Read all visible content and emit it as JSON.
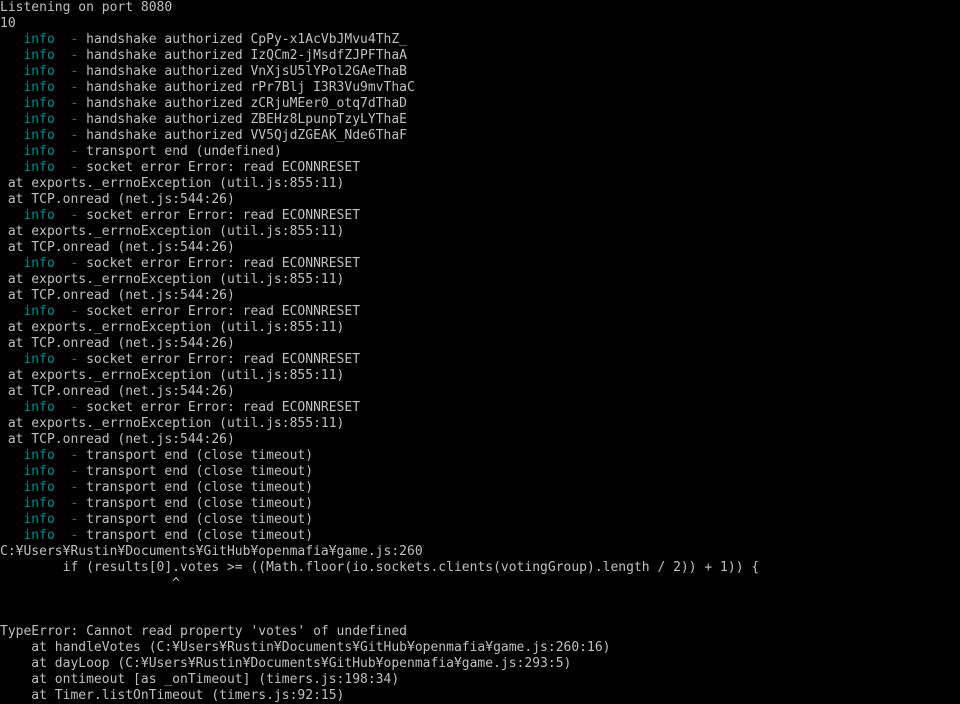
{
  "terminal": {
    "title": "node-console",
    "colors": {
      "background": "#000000",
      "foreground": "#c0c0c0",
      "info": "#008b8b"
    },
    "columns": 120,
    "rows": 44,
    "lines": [
      {
        "indent": 0,
        "parts": [
          {
            "color": "fg",
            "text": "Listening on port 8080"
          }
        ]
      },
      {
        "indent": 0,
        "parts": [
          {
            "color": "fg",
            "text": "10"
          }
        ]
      },
      {
        "indent": 0,
        "parts": [
          {
            "color": "info",
            "text": "   info  -"
          },
          {
            "color": "fg",
            "text": " handshake authorized CpPy-x1AcVbJMvu4ThZ_"
          }
        ]
      },
      {
        "indent": 0,
        "parts": [
          {
            "color": "info",
            "text": "   info  -"
          },
          {
            "color": "fg",
            "text": " handshake authorized IzQCm2-jMsdfZJPFThaA"
          }
        ]
      },
      {
        "indent": 0,
        "parts": [
          {
            "color": "info",
            "text": "   info  -"
          },
          {
            "color": "fg",
            "text": " handshake authorized VnXjsU5lYPol2GAeThaB"
          }
        ]
      },
      {
        "indent": 0,
        "parts": [
          {
            "color": "info",
            "text": "   info  -"
          },
          {
            "color": "fg",
            "text": " handshake authorized rPr7Blj I3R3Vu9mvThaC"
          }
        ]
      },
      {
        "indent": 0,
        "parts": [
          {
            "color": "info",
            "text": "   info  -"
          },
          {
            "color": "fg",
            "text": " handshake authorized zCRjuMEer0_otq7dThaD"
          }
        ]
      },
      {
        "indent": 0,
        "parts": [
          {
            "color": "info",
            "text": "   info  -"
          },
          {
            "color": "fg",
            "text": " handshake authorized ZBEHz8LpunpTzyLYThaE"
          }
        ]
      },
      {
        "indent": 0,
        "parts": [
          {
            "color": "info",
            "text": "   info  -"
          },
          {
            "color": "fg",
            "text": " handshake authorized VV5QjdZGEAK_Nde6ThaF"
          }
        ]
      },
      {
        "indent": 0,
        "parts": [
          {
            "color": "info",
            "text": "   info  -"
          },
          {
            "color": "fg",
            "text": " transport end (undefined)"
          }
        ]
      },
      {
        "indent": 0,
        "parts": [
          {
            "color": "info",
            "text": "   info  -"
          },
          {
            "color": "fg",
            "text": " socket error Error: read ECONNRESET"
          }
        ]
      },
      {
        "indent": 0,
        "parts": [
          {
            "color": "fg",
            "text": " at exports._errnoException (util.js:855:11)"
          }
        ]
      },
      {
        "indent": 0,
        "parts": [
          {
            "color": "fg",
            "text": " at TCP.onread (net.js:544:26)"
          }
        ]
      },
      {
        "indent": 0,
        "parts": [
          {
            "color": "info",
            "text": "   info  -"
          },
          {
            "color": "fg",
            "text": " socket error Error: read ECONNRESET"
          }
        ]
      },
      {
        "indent": 0,
        "parts": [
          {
            "color": "fg",
            "text": " at exports._errnoException (util.js:855:11)"
          }
        ]
      },
      {
        "indent": 0,
        "parts": [
          {
            "color": "fg",
            "text": " at TCP.onread (net.js:544:26)"
          }
        ]
      },
      {
        "indent": 0,
        "parts": [
          {
            "color": "info",
            "text": "   info  -"
          },
          {
            "color": "fg",
            "text": " socket error Error: read ECONNRESET"
          }
        ]
      },
      {
        "indent": 0,
        "parts": [
          {
            "color": "fg",
            "text": " at exports._errnoException (util.js:855:11)"
          }
        ]
      },
      {
        "indent": 0,
        "parts": [
          {
            "color": "fg",
            "text": " at TCP.onread (net.js:544:26)"
          }
        ]
      },
      {
        "indent": 0,
        "parts": [
          {
            "color": "info",
            "text": "   info  -"
          },
          {
            "color": "fg",
            "text": " socket error Error: read ECONNRESET"
          }
        ]
      },
      {
        "indent": 0,
        "parts": [
          {
            "color": "fg",
            "text": " at exports._errnoException (util.js:855:11)"
          }
        ]
      },
      {
        "indent": 0,
        "parts": [
          {
            "color": "fg",
            "text": " at TCP.onread (net.js:544:26)"
          }
        ]
      },
      {
        "indent": 0,
        "parts": [
          {
            "color": "info",
            "text": "   info  -"
          },
          {
            "color": "fg",
            "text": " socket error Error: read ECONNRESET"
          }
        ]
      },
      {
        "indent": 0,
        "parts": [
          {
            "color": "fg",
            "text": " at exports._errnoException (util.js:855:11)"
          }
        ]
      },
      {
        "indent": 0,
        "parts": [
          {
            "color": "fg",
            "text": " at TCP.onread (net.js:544:26)"
          }
        ]
      },
      {
        "indent": 0,
        "parts": [
          {
            "color": "info",
            "text": "   info  -"
          },
          {
            "color": "fg",
            "text": " socket error Error: read ECONNRESET"
          }
        ]
      },
      {
        "indent": 0,
        "parts": [
          {
            "color": "fg",
            "text": " at exports._errnoException (util.js:855:11)"
          }
        ]
      },
      {
        "indent": 0,
        "parts": [
          {
            "color": "fg",
            "text": " at TCP.onread (net.js:544:26)"
          }
        ]
      },
      {
        "indent": 0,
        "parts": [
          {
            "color": "info",
            "text": "   info  -"
          },
          {
            "color": "fg",
            "text": " transport end (close timeout)"
          }
        ]
      },
      {
        "indent": 0,
        "parts": [
          {
            "color": "info",
            "text": "   info  -"
          },
          {
            "color": "fg",
            "text": " transport end (close timeout)"
          }
        ]
      },
      {
        "indent": 0,
        "parts": [
          {
            "color": "info",
            "text": "   info  -"
          },
          {
            "color": "fg",
            "text": " transport end (close timeout)"
          }
        ]
      },
      {
        "indent": 0,
        "parts": [
          {
            "color": "info",
            "text": "   info  -"
          },
          {
            "color": "fg",
            "text": " transport end (close timeout)"
          }
        ]
      },
      {
        "indent": 0,
        "parts": [
          {
            "color": "info",
            "text": "   info  -"
          },
          {
            "color": "fg",
            "text": " transport end (close timeout)"
          }
        ]
      },
      {
        "indent": 0,
        "parts": [
          {
            "color": "info",
            "text": "   info  -"
          },
          {
            "color": "fg",
            "text": " transport end (close timeout)"
          }
        ]
      },
      {
        "indent": 0,
        "parts": [
          {
            "color": "fg",
            "text": "C:¥Users¥Rustin¥Documents¥GitHub¥openmafia¥game.js:260"
          }
        ]
      },
      {
        "indent": 0,
        "parts": [
          {
            "color": "fg",
            "text": "        if (results[0].votes >= ((Math.floor(io.sockets.clients(votingGroup).length / 2)) + 1)) {"
          }
        ]
      },
      {
        "indent": 0,
        "parts": [
          {
            "color": "fg",
            "text": "                      ^"
          }
        ]
      },
      {
        "indent": 0,
        "parts": [
          {
            "color": "fg",
            "text": ""
          }
        ]
      },
      {
        "indent": 0,
        "parts": [
          {
            "color": "fg",
            "text": ""
          }
        ]
      },
      {
        "indent": 0,
        "parts": [
          {
            "color": "fg",
            "text": "TypeError: Cannot read property 'votes' of undefined"
          }
        ]
      },
      {
        "indent": 0,
        "parts": [
          {
            "color": "fg",
            "text": "    at handleVotes (C:¥Users¥Rustin¥Documents¥GitHub¥openmafia¥game.js:260:16)"
          }
        ]
      },
      {
        "indent": 0,
        "parts": [
          {
            "color": "fg",
            "text": "    at dayLoop (C:¥Users¥Rustin¥Documents¥GitHub¥openmafia¥game.js:293:5)"
          }
        ]
      },
      {
        "indent": 0,
        "parts": [
          {
            "color": "fg",
            "text": "    at ontimeout [as _onTimeout] (timers.js:198:34)"
          }
        ]
      },
      {
        "indent": 0,
        "parts": [
          {
            "color": "fg",
            "text": "    at Timer.listOnTimeout (timers.js:92:15)"
          }
        ]
      }
    ]
  }
}
